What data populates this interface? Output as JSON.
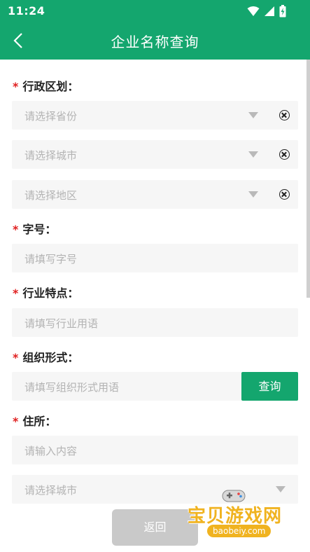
{
  "status_bar": {
    "time": "11:24"
  },
  "header": {
    "title": "企业名称查询"
  },
  "form": {
    "region": {
      "label": "行政区划：",
      "province_placeholder": "请选择省份",
      "city_placeholder": "请选择城市",
      "district_placeholder": "请选择地区"
    },
    "trade_name": {
      "label": "字号：",
      "placeholder": "请填写字号"
    },
    "industry": {
      "label": "行业特点：",
      "placeholder": "请填写行业用语"
    },
    "org_form": {
      "label": "组织形式：",
      "placeholder": "请填写组织形式用语",
      "query_label": "查询"
    },
    "address": {
      "label": "住所：",
      "placeholder": "请输入内容",
      "city_placeholder": "请选择城市"
    },
    "required_mark": "*"
  },
  "footer": {
    "back_label": "返回"
  },
  "watermark": {
    "title": "宝贝游戏网",
    "url": "baobeiy.com"
  },
  "colors": {
    "primary": "#14a66e",
    "required": "#e02020",
    "field_bg": "#f6f6f6"
  }
}
